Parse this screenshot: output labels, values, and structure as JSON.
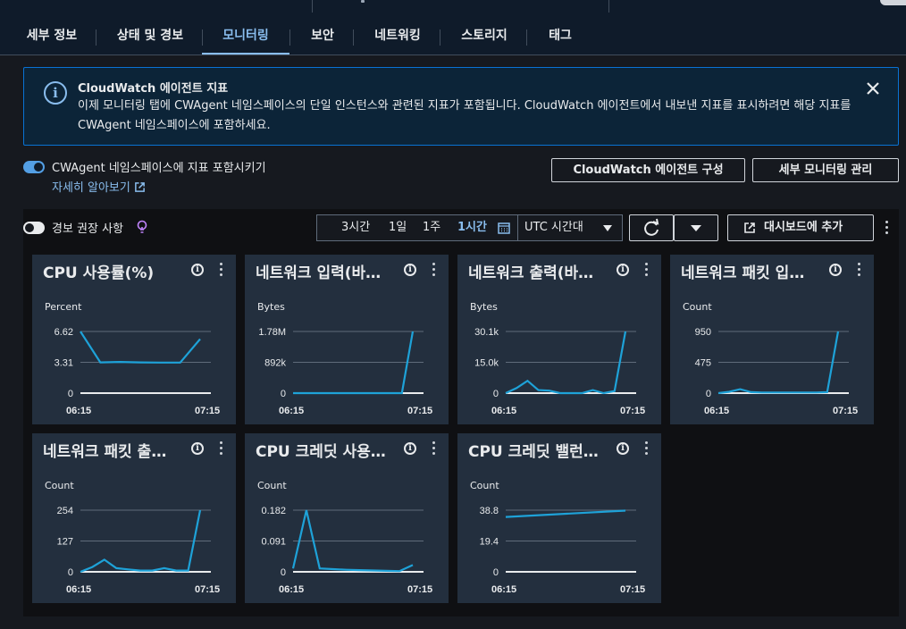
{
  "tabs": [
    "세부 정보",
    "상태 및 경보",
    "모니터링",
    "보안",
    "네트워킹",
    "스토리지",
    "태그"
  ],
  "active_tab": "모니터링",
  "info_banner": {
    "title": "CloudWatch 에이전트 지표",
    "body": "이제 모니터링 탭에 CWAgent 네임스페이스의 단일 인스턴스와 관련된 지표가 포함됩니다. CloudWatch 에이전트에서 내보낸 지표를 표시하려면 해당 지표를 CWAgent 네임스페이스에 포함하세요."
  },
  "cwagent_toggle": {
    "label": "CWAgent 네임스페이스에 지표 포함시키기",
    "on": true
  },
  "learn_more": "자세히 알아보기",
  "buttons": {
    "configure": "CloudWatch 에이전트 구성",
    "manage": "세부 모니터링 관리",
    "add_dashboard": "대시보드에 추가"
  },
  "alarm_toggle": {
    "label": "경보 권장 사항",
    "on": false
  },
  "time_range": {
    "options": [
      "3시간",
      "1일",
      "1주",
      "1시간"
    ],
    "selected": "1시간",
    "timezone": "UTC 시간대"
  },
  "colors": {
    "accent": "#89bdee",
    "line": "#1ea2d8",
    "info_border": "#0972d3"
  },
  "chart_data": [
    {
      "type": "line",
      "title": "CPU 사용률(%)",
      "ylabel": "Percent",
      "yticks": [
        "6.62",
        "3.31",
        "0"
      ],
      "ylim": [
        0,
        6.62
      ],
      "xticks": [
        "06:15",
        "07:15"
      ],
      "y": [
        6.62,
        3.3,
        3.35,
        3.3,
        3.28,
        3.28,
        5.8
      ]
    },
    {
      "type": "line",
      "title": "네트워크 입력(바…",
      "ylabel": "Bytes",
      "yticks": [
        "1.78M",
        "892k",
        "0"
      ],
      "ylim": [
        0,
        1780000
      ],
      "xticks": [
        "06:15",
        "07:15"
      ],
      "y": [
        0,
        0,
        0,
        0,
        0,
        0,
        0,
        0,
        0,
        0,
        0,
        1780000
      ]
    },
    {
      "type": "line",
      "title": "네트워크 출력(바…",
      "ylabel": "Bytes",
      "yticks": [
        "30.1k",
        "15.0k",
        "0"
      ],
      "ylim": [
        0,
        30100
      ],
      "xticks": [
        "06:15",
        "07:15"
      ],
      "y": [
        0,
        2500,
        6000,
        1500,
        1200,
        0,
        0,
        0,
        1500,
        0,
        1000,
        30100
      ]
    },
    {
      "type": "line",
      "title": "네트워크 패킷 입…",
      "ylabel": "Count",
      "yticks": [
        "950",
        "475",
        "0"
      ],
      "ylim": [
        0,
        950
      ],
      "xticks": [
        "06:15",
        "07:15"
      ],
      "y": [
        0,
        20,
        60,
        15,
        10,
        10,
        10,
        10,
        10,
        10,
        15,
        950
      ]
    },
    {
      "type": "line",
      "title": "네트워크 패킷 출…",
      "ylabel": "Count",
      "yticks": [
        "254",
        "127",
        "0"
      ],
      "ylim": [
        0,
        254
      ],
      "xticks": [
        "06:15",
        "07:15"
      ],
      "y": [
        0,
        20,
        50,
        15,
        10,
        5,
        5,
        15,
        5,
        5,
        254
      ]
    },
    {
      "type": "line",
      "title": "CPU 크레딧 사용…",
      "ylabel": "Count",
      "yticks": [
        "0.182",
        "0.091",
        "0"
      ],
      "ylim": [
        0,
        0.182
      ],
      "xticks": [
        "06:15",
        "07:15"
      ],
      "y": [
        0.01,
        0.182,
        0.01,
        0.008,
        0.006,
        0.005,
        0.004,
        0.003,
        0.002,
        0.02
      ]
    },
    {
      "type": "line",
      "title": "CPU 크레딧 밸런…",
      "ylabel": "Count",
      "yticks": [
        "38.8",
        "19.4",
        "0"
      ],
      "ylim": [
        0,
        38.8
      ],
      "xticks": [
        "06:15",
        "07:15"
      ],
      "y": [
        34.5,
        38.5
      ]
    }
  ]
}
